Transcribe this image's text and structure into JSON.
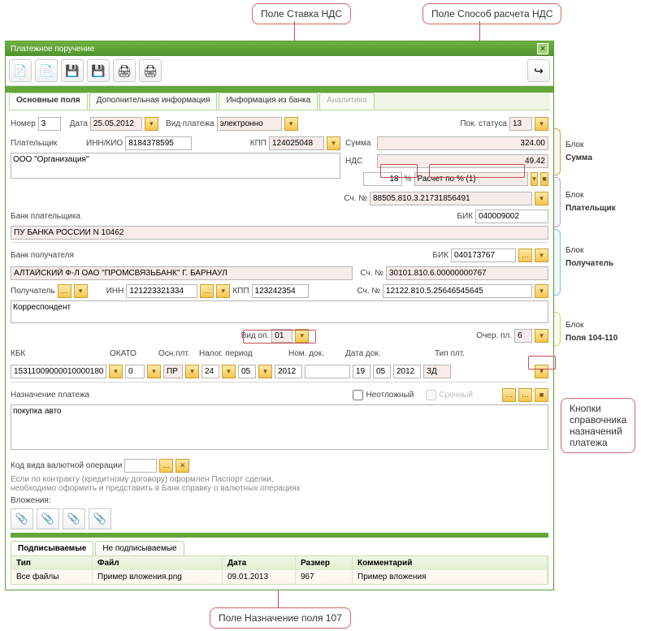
{
  "callouts": {
    "vat_rate": "Поле Ставка НДС",
    "vat_calc": "Поле Способ расчета НДС",
    "field107": "Поле Назначение поля 107",
    "btns_ref": "Кнопки\nсправочника\nназначений\nплатежа"
  },
  "side_blocks": {
    "b1": "Блок\nСумма",
    "b2": "Блок\nПлательщик",
    "b3": "Блок\nПолучатель",
    "b4": "Блок\nПоля 104-110"
  },
  "window": {
    "title": "Платежное поручение",
    "close": "×"
  },
  "toolbar": {
    "icons": [
      "📄",
      "📄",
      "💾",
      "💾",
      "🖨",
      "🖨"
    ],
    "right": "➡"
  },
  "tabs": {
    "main": "Основные поля",
    "extra": "Дополнительная информация",
    "bank": "Информация из банка",
    "an": "Аналитика"
  },
  "header": {
    "lbl_num": "Номер",
    "num": "3",
    "lbl_date": "Дата",
    "date": "25.05.2012",
    "lbl_type": "Вид платежа",
    "type": "электронно",
    "lbl_status": "Пок. статуса",
    "status": "13"
  },
  "sum": {
    "lbl_sum": "Сумма",
    "sum": "324.00",
    "lbl_nds": "НДС",
    "nds": "49.42",
    "rate": "18",
    "pct": "%",
    "method": "Расчет по % (1)"
  },
  "payer": {
    "lbl": "Плательщик",
    "lbl_inn": "ИНН/КИО",
    "inn": "8184378595",
    "lbl_kpp": "КПП",
    "kpp": "124025048",
    "name": "ООО \"Организация\"",
    "lbl_acc": "Сч. №",
    "acc": "88505.810.3.21731856491",
    "lbl_bank": "Банк плательщика",
    "bank": "ПУ БАНКА РОССИИ N 10462",
    "lbl_bik": "БИК",
    "bik": "040009002"
  },
  "payee": {
    "lbl_bank": "Банк получателя",
    "bank": "АЛТАЙСКИЙ Ф-Л ОАО \"ПРОМСВЯЗЬБАНК\" Г. БАРНАУЛ",
    "lbl_bik": "БИК",
    "bik": "040173767",
    "lbl_acc": "Сч. №",
    "acc": "30101.810.6.00000000767",
    "lbl": "Получатель",
    "lbl_inn": "ИНН",
    "inn": "121223321334",
    "lbl_kpp": "КПП",
    "kpp": "123242354",
    "lbl_acc2": "Сч. №",
    "acc2": "12122.810.5.25646545645",
    "name": "Корреспондент"
  },
  "op": {
    "lbl_vid": "Вид оп.",
    "vid": "01",
    "lbl_queue": "Очер. пл.",
    "queue": "6"
  },
  "fields104": {
    "lbl_kbk": "КБК",
    "kbk": "15311009000010000180",
    "lbl_okato": "ОКАТО",
    "okato": "0",
    "lbl_osn": "Осн.плт.",
    "osn": "ПР",
    "lbl_period": "Налог. период",
    "p1": "24",
    "p2": "05",
    "p3": "2012",
    "lbl_ndoc": "Ном. док.",
    "ndoc": "",
    "lbl_ddoc": "Дата док.",
    "d1": "19",
    "d2": "05",
    "d3": "2012",
    "lbl_tip": "Тип плт.",
    "tip": "ЗД"
  },
  "purpose": {
    "lbl": "Назначение платежа",
    "cb_urgent": "Неотложный",
    "cb_urgent_checked": false,
    "srochny": "Срочный",
    "text": "покупка авто"
  },
  "currency": {
    "lbl": "Код вида валютной операции",
    "val": "",
    "note1": "Если по контракту (кредитному договору) оформлен Паспорт сделки,",
    "note2": "необходимо оформить и представить в Банк справку о валютных операциях",
    "lbl_att": "Вложения:"
  },
  "filetabs": {
    "signed": "Подписываемые",
    "unsigned": "Не подписываемые"
  },
  "filetable": {
    "h_type": "Тип",
    "h_file": "Файл",
    "h_date": "Дата",
    "h_size": "Размер",
    "h_comm": "Комментарий",
    "r_type": "Все файлы",
    "r_file": "Пример вложения.png",
    "r_date": "09.01.2013",
    "r_size": "967",
    "r_comm": "Пример вложения"
  }
}
